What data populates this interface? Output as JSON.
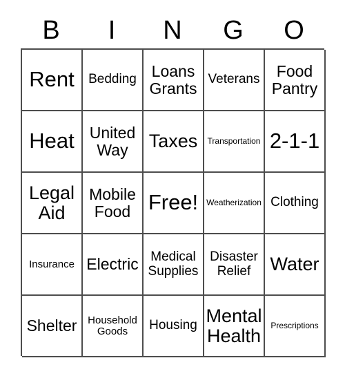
{
  "card": {
    "title": "BINGO",
    "header_letters": [
      "B",
      "I",
      "N",
      "G",
      "O"
    ],
    "border_color": "#4d4d4d",
    "background_color": "#ffffff",
    "text_color": "#000000",
    "columns": 5,
    "rows": 5,
    "free_space": "Free!",
    "cells": [
      [
        {
          "label": "Rent",
          "size": "fs-xxl"
        },
        {
          "label": "Bedding",
          "size": "fs-md"
        },
        {
          "label": "Loans Grants",
          "size": "fs-lg"
        },
        {
          "label": "Veterans",
          "size": "fs-md"
        },
        {
          "label": "Food Pantry",
          "size": "fs-lg"
        }
      ],
      [
        {
          "label": "Heat",
          "size": "fs-xxl"
        },
        {
          "label": "United Way",
          "size": "fs-lg"
        },
        {
          "label": "Taxes",
          "size": "fs-xl"
        },
        {
          "label": "Transportation",
          "size": "fs-xs"
        },
        {
          "label": "2-1-1",
          "size": "fs-xxl"
        }
      ],
      [
        {
          "label": "Legal Aid",
          "size": "fs-xl"
        },
        {
          "label": "Mobile Food",
          "size": "fs-lg"
        },
        {
          "label": "Free!",
          "size": "fs-xxl"
        },
        {
          "label": "Weatherization",
          "size": "fs-xs"
        },
        {
          "label": "Clothing",
          "size": "fs-md"
        }
      ],
      [
        {
          "label": "Insurance",
          "size": "fs-sm"
        },
        {
          "label": "Electric",
          "size": "fs-lg"
        },
        {
          "label": "Medical Supplies",
          "size": "fs-md"
        },
        {
          "label": "Disaster Relief",
          "size": "fs-md"
        },
        {
          "label": "Water",
          "size": "fs-xl"
        }
      ],
      [
        {
          "label": "Shelter",
          "size": "fs-lg"
        },
        {
          "label": "Household Goods",
          "size": "fs-sm"
        },
        {
          "label": "Housing",
          "size": "fs-md"
        },
        {
          "label": "Mental Health",
          "size": "fs-xl"
        },
        {
          "label": "Prescriptions",
          "size": "fs-xs"
        }
      ]
    ]
  }
}
